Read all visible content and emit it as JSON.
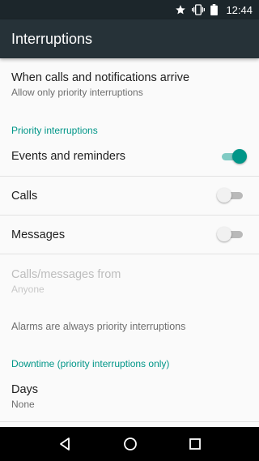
{
  "status_bar": {
    "time": "12:44",
    "icons": [
      "star-icon",
      "vibrate-icon",
      "battery-icon"
    ]
  },
  "app_bar": {
    "title": "Interruptions"
  },
  "settings": {
    "when_arrive": {
      "title": "When calls and notifications arrive",
      "summary": "Allow only priority interruptions"
    },
    "priority_header": "Priority interruptions",
    "events_reminders": {
      "title": "Events and reminders",
      "enabled": true
    },
    "calls": {
      "title": "Calls",
      "enabled": false
    },
    "messages": {
      "title": "Messages",
      "enabled": false
    },
    "calls_messages_from": {
      "title": "Calls/messages from",
      "summary": "Anyone",
      "disabled": true
    },
    "alarms_note": "Alarms are always priority interruptions",
    "downtime_header": "Downtime (priority interruptions only)",
    "days": {
      "title": "Days",
      "summary": "None"
    }
  },
  "nav_bar": {
    "icons": [
      "back-icon",
      "home-icon",
      "recents-icon"
    ]
  },
  "colors": {
    "accent": "#009688",
    "toolbar": "#263238",
    "status_bar": "#1c262b"
  }
}
